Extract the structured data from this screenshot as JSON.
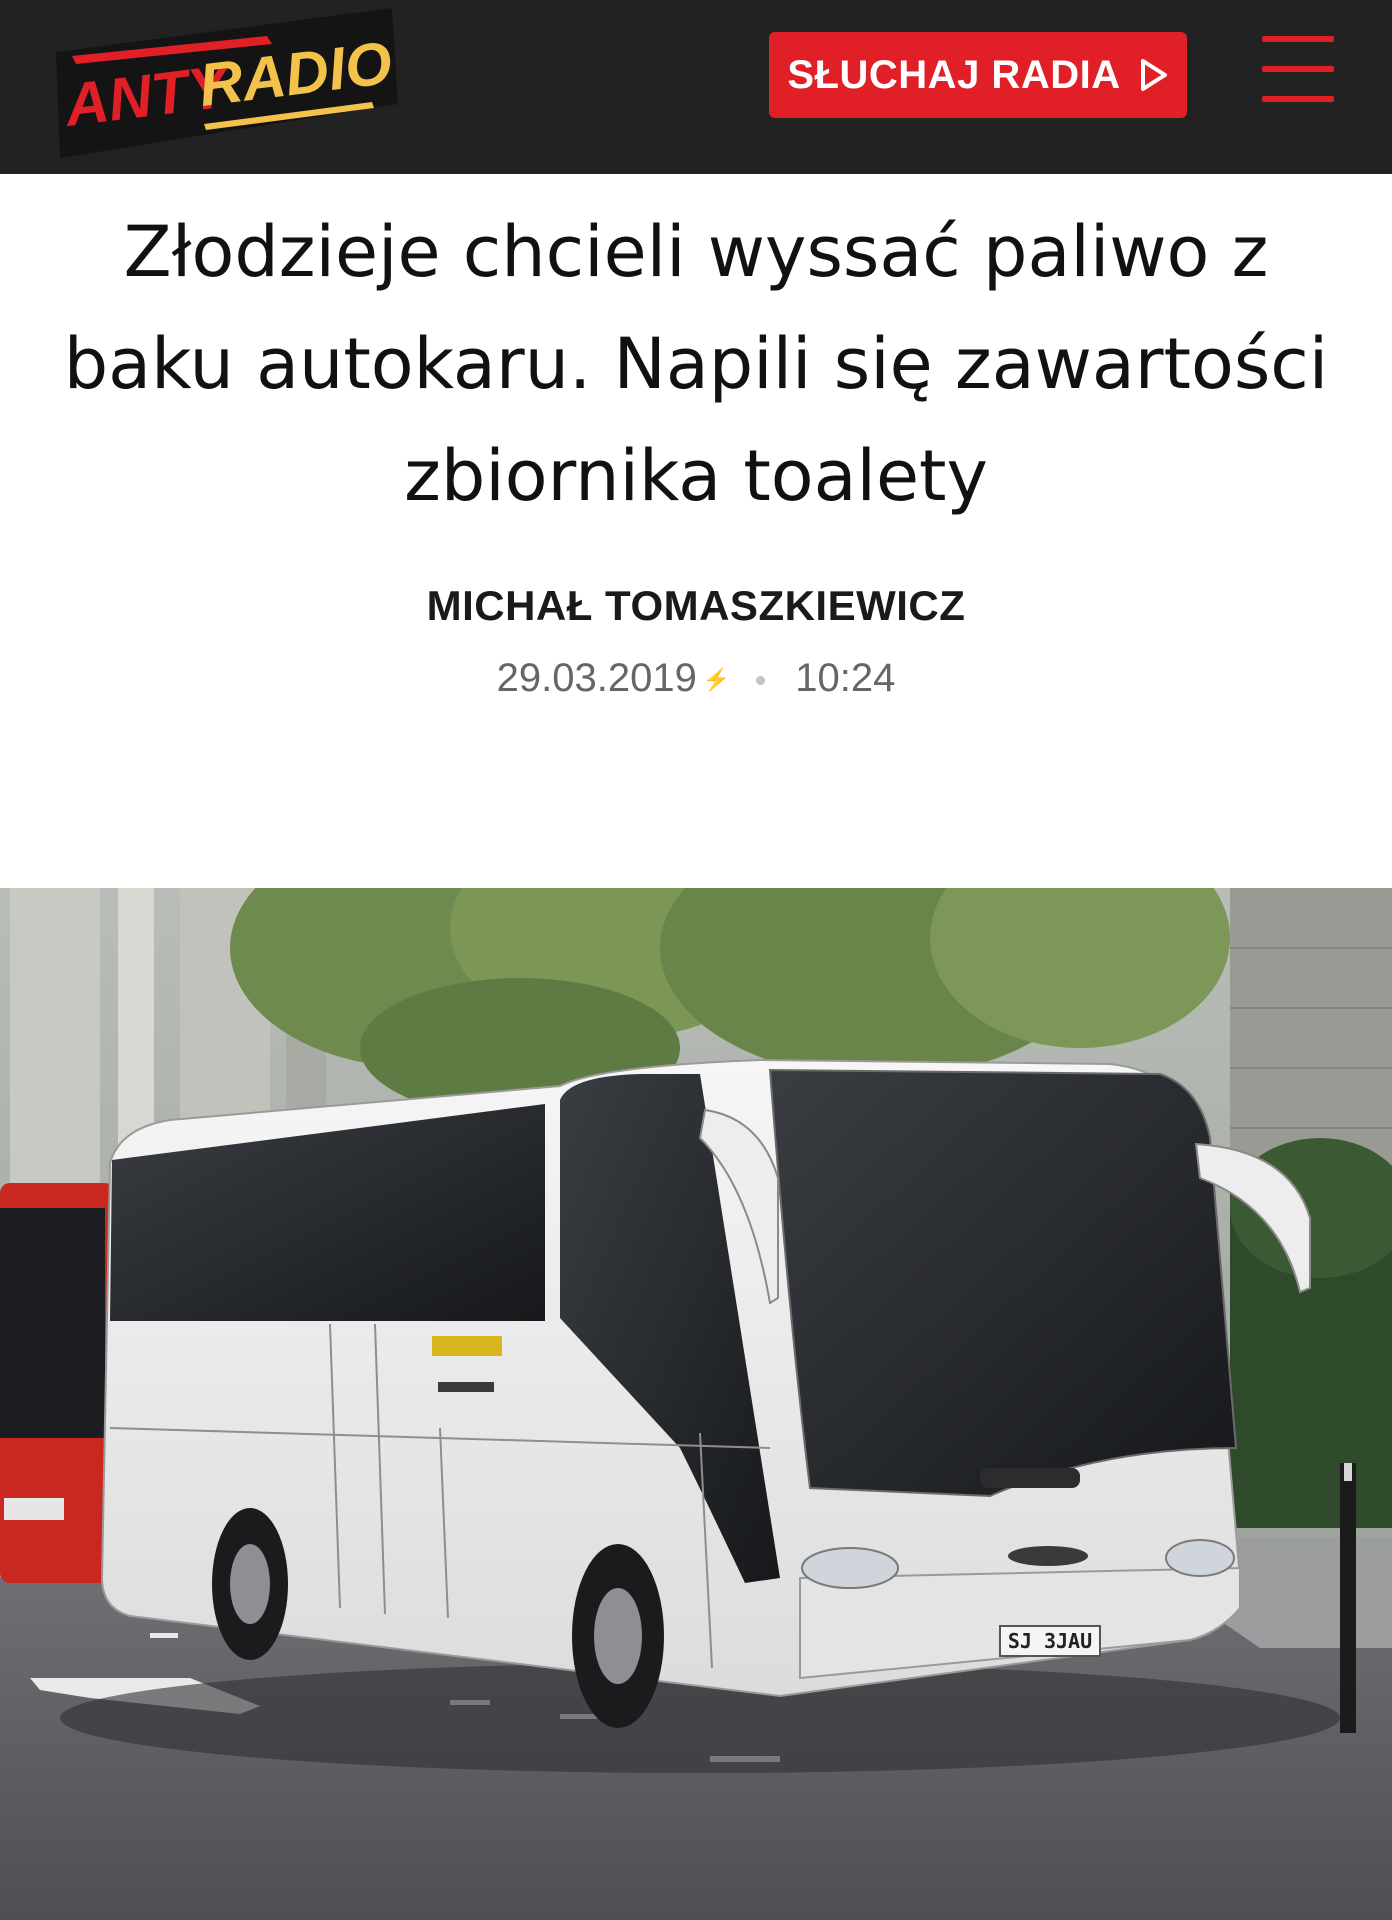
{
  "header": {
    "logo_text_part1": "ANTY",
    "logo_text_part2": "RADIO",
    "listen_button_label": "SŁUCHAJ RADIA",
    "colors": {
      "bar": "#222222",
      "accent": "#e01f26",
      "logo_yellow": "#f2c24b"
    }
  },
  "article": {
    "title": "Złodzieje chcieli wyssać paliwo z baku autokaru. Napili się zawartości zbiornika toalety",
    "author": "MICHAŁ TOMASZKIEWICZ",
    "date": "29.03.2019",
    "time": "10:24"
  },
  "hero_image": {
    "subject": "white coach bus parked on a city street",
    "plate_text": "SJ 3JAU"
  }
}
